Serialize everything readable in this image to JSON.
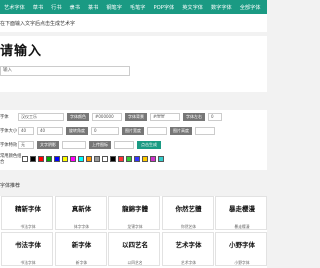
{
  "nav": {
    "items": [
      "艺术字体",
      "草书",
      "行书",
      "隶书",
      "篆书",
      "钢笔字",
      "毛笔字",
      "POP字体",
      "英文字体",
      "数字字体",
      "全部字体"
    ]
  },
  "hint": "在下面输入文字后点击生成艺术字",
  "preview": {
    "art_text": "请输入",
    "input_value": "输入"
  },
  "controls": {
    "row1": {
      "label": "字体",
      "font_value": "汉仪工乐",
      "size_label": "字体颜色",
      "color_value": "#000000",
      "bg_label": "字体背景",
      "bg_value": "#ffffff",
      "pos_label": "字体左右",
      "pos_value": "0"
    },
    "row2": {
      "label": "字体大小",
      "size_value": "40",
      "width_value": "40",
      "angle_label": "旋转角度",
      "angle_value": "0",
      "w_label": "图片宽度",
      "h_label": "图片高度"
    },
    "row3": {
      "label": "字体特效",
      "effect_value": "无",
      "shadow_label": "文字阴影",
      "upload_label": "上传图标",
      "submit_label": "点击生成"
    },
    "row4": {
      "label": "常用颜色组合"
    },
    "swatch_colors": [
      "#ffffff",
      "#000000",
      "#ff0000",
      "#00aa00",
      "#0000ff",
      "#ffff00",
      "#ff00ff",
      "#00ffff",
      "#ff9900",
      "#999999",
      "#ffffff",
      "#000000",
      "#ff3333",
      "#33cc33",
      "#3333ff",
      "#ffcc00",
      "#cc33cc",
      "#33cccc"
    ]
  },
  "section_title": "字体推荐",
  "cards": [
    {
      "art": "精新字体",
      "label": "书法字体"
    },
    {
      "art": "真新体",
      "label": "体字字体"
    },
    {
      "art": "龍錦字體",
      "label": "龙锦字体"
    },
    {
      "art": "你然艺體",
      "label": "你然艺体"
    },
    {
      "art": "暴走樱漫",
      "label": "暴走樱漫"
    },
    {
      "art": "书法字体",
      "label": "书法字体"
    },
    {
      "art": "新字体",
      "label": "新字体"
    },
    {
      "art": "以四艺名",
      "label": "以四艺名"
    },
    {
      "art": "艺术字体",
      "label": "艺术字体"
    },
    {
      "art": "小野字体",
      "label": "小野字体"
    }
  ]
}
